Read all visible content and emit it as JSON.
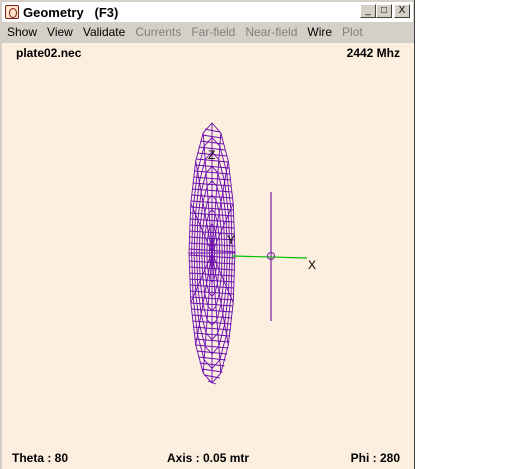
{
  "window": {
    "title": "Geometry   (F3)",
    "buttons": {
      "minimize": "_",
      "maximize": "□",
      "close": "X"
    }
  },
  "menu": [
    {
      "label": "Show",
      "enabled": true
    },
    {
      "label": "View",
      "enabled": true
    },
    {
      "label": "Validate",
      "enabled": true
    },
    {
      "label": "Currents",
      "enabled": false
    },
    {
      "label": "Far-field",
      "enabled": false
    },
    {
      "label": "Near-field",
      "enabled": false
    },
    {
      "label": "Wire",
      "enabled": true
    },
    {
      "label": "Plot",
      "enabled": false
    }
  ],
  "canvas": {
    "filename": "plate02.nec",
    "frequency": "2442 Mhz",
    "theta": "Theta : 80",
    "axis": "Axis : 0.05 mtr",
    "phi": "Phi : 280",
    "axis_labels": {
      "z": "Z",
      "y": "Y",
      "x": "X"
    },
    "colors": {
      "background": "#fdefe0",
      "plate": "#6a0dad",
      "wire": "#7a1fa0",
      "axis_x": "#00c000"
    }
  }
}
